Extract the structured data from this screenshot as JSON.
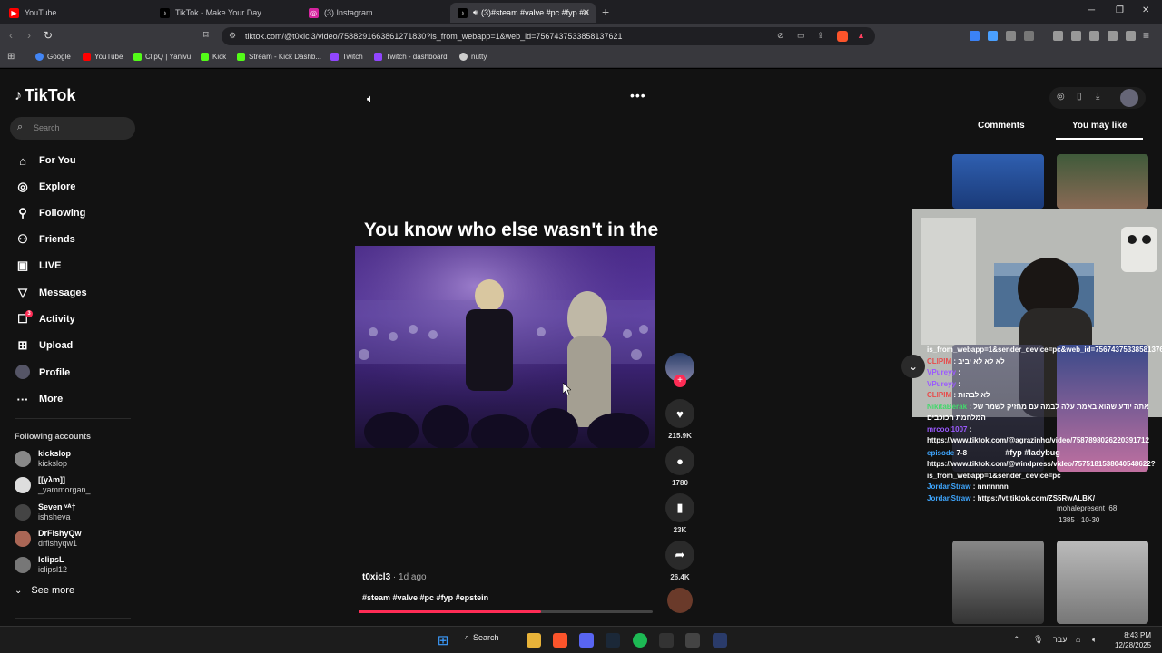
{
  "browser": {
    "tabs": [
      {
        "title": "YouTube",
        "color": "#ff0000"
      },
      {
        "title": "TikTok - Make Your Day",
        "color": "#000000"
      },
      {
        "title": "(3) Instagram",
        "color": "#d6249f"
      },
      {
        "title": "(3)#steam #valve #pc #fyp #e",
        "color": "#000000"
      }
    ],
    "url": "tiktok.com/@t0xicl3/video/7588291663861271830?is_from_webapp=1&web_id=7567437533858137621",
    "bookmarks": [
      {
        "label": "Google",
        "color": "#4285f4"
      },
      {
        "label": "YouTube",
        "color": "#ff0000"
      },
      {
        "label": "ClipQ | Yanivu",
        "color": "#53fc18"
      },
      {
        "label": "Kick",
        "color": "#53fc18"
      },
      {
        "label": "Stream - Kick Dashb...",
        "color": "#53fc18"
      },
      {
        "label": "Twitch",
        "color": "#9146ff"
      },
      {
        "label": "Twitch - dashboard",
        "color": "#9146ff"
      },
      {
        "label": "nutty",
        "color": "#cccccc"
      }
    ]
  },
  "sidebar": {
    "brand": "TikTok",
    "search_placeholder": "Search",
    "nav": [
      {
        "label": "For You",
        "icon": "home-icon"
      },
      {
        "label": "Explore",
        "icon": "compass-icon"
      },
      {
        "label": "Following",
        "icon": "user-follow-icon"
      },
      {
        "label": "Friends",
        "icon": "friends-icon"
      },
      {
        "label": "LIVE",
        "icon": "live-icon"
      },
      {
        "label": "Messages",
        "icon": "send-icon"
      },
      {
        "label": "Activity",
        "icon": "activity-icon",
        "badge": "3"
      },
      {
        "label": "Upload",
        "icon": "upload-icon"
      },
      {
        "label": "Profile",
        "icon": "avatar"
      },
      {
        "label": "More",
        "icon": "more-icon"
      }
    ],
    "following_title": "Following accounts",
    "accounts": [
      {
        "name": "kickslop",
        "handle": "kickslop",
        "color": "#888888"
      },
      {
        "name": "[[γλm]]",
        "handle": "_yammorgan_",
        "color": "#dddddd"
      },
      {
        "name": "Seven ᵛᴬ†",
        "handle": "ishsheva",
        "color": "#444444"
      },
      {
        "name": "DrFishyQw",
        "handle": "drfishyqw1",
        "color": "#aa6655"
      },
      {
        "name": "lclipsL",
        "handle": "iclipsl12",
        "color": "#777777"
      }
    ],
    "see_more": "See more"
  },
  "video": {
    "overlay_text": "You know who else wasn't in the Epstein files?",
    "author": "t0xicl3",
    "age": " · 1d ago",
    "tags": "#steam #valve #pc #fyp #epstein",
    "progress": 0.62,
    "actions": [
      {
        "name": "like",
        "count": "215.9K"
      },
      {
        "name": "comment",
        "count": "1780"
      },
      {
        "name": "save",
        "count": "23K"
      },
      {
        "name": "share",
        "count": "26.4K"
      }
    ]
  },
  "right_panel": {
    "tabs": [
      "Comments",
      "You may like"
    ],
    "reco_captions": [
      "#fyp #ladybug",
      "mohalepresent_68",
      "1385 · 10-30"
    ],
    "chat": [
      {
        "user": "",
        "msg": "is_from_webapp=1&sender_device=pc&web_id=7567437533858137621"
      },
      {
        "user": "CLIPIM",
        "msg": "לא לא לא יביב"
      },
      {
        "user": "VPureyy",
        "msg": ""
      },
      {
        "user": "VPureyy",
        "msg": ""
      },
      {
        "user": "CLIPIM",
        "msg": "לא לבהות"
      },
      {
        "user": "NikitaBerak",
        "msg": "אתה יודע שהוא באמת עלה לבמה עם מחזיק לשמר של המלחמת הכוכבים"
      },
      {
        "user": "mrcool1007",
        "msg": ""
      },
      {
        "user": "",
        "msg": "https://www.tiktok.com/@agrazinho/video/7587898026220391712"
      },
      {
        "user": "episode",
        "msg": "7-8"
      },
      {
        "user": "",
        "msg": "https://www.tiktok.com/@windpress/video/7575181538040548622?is_from_webapp=1&sender_device=pc"
      },
      {
        "user": "JordanStraw",
        "msg": "nnnnnnn"
      },
      {
        "user": "JordanStraw",
        "msg": "https://vt.tiktok.com/ZS5RwALBK/"
      }
    ]
  },
  "taskbar": {
    "search_label": "Search",
    "lang": "עבר",
    "time": "8:43 PM",
    "date": "12/28/2025"
  }
}
